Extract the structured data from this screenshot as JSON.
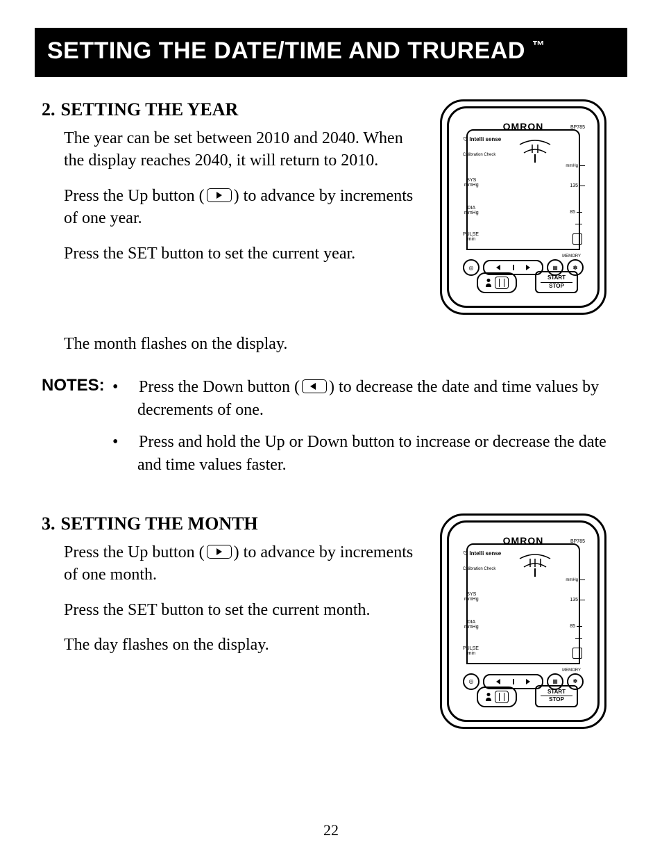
{
  "title": "SETTING THE DATE/TIME AND TRUREAD",
  "tm": "™",
  "sec2": {
    "num": "2.",
    "heading": "SETTING THE YEAR",
    "p1": "The year can be set between 2010 and 2040. When the display reaches 2040, it will return to 2010.",
    "p2a": "Press the Up button (",
    "p2b": ") to advance by increments of one year.",
    "p3": "Press the SET button to set the current year.",
    "p4": "The month flashes on the display."
  },
  "notes": {
    "label": "NOTES:",
    "n1a": "Press the Down button (",
    "n1b": ") to decrease the date and time values by decrements of one.",
    "n2": "Press and hold the Up or Down button to increase or decrease the date and time values faster."
  },
  "sec3": {
    "num": "3.",
    "heading": "SETTING THE MONTH",
    "p1a": "Press the Up button (",
    "p1b": ") to advance by increments of one month.",
    "p2": "Press the SET button to set the current month.",
    "p3": "The day flashes on the display."
  },
  "device": {
    "brand": "OMRON",
    "model": "BP785",
    "intelli": "Intelli sense",
    "cal": "Calibration Check",
    "sys": "SYS",
    "sys_u": "mmHg",
    "dia": "DIA",
    "dia_u": "mmHg",
    "pulse": "PULSE",
    "pulse_u": "/min",
    "mmhg": "mmHg",
    "v135": "135",
    "v85": "85",
    "memory": "MEMORY",
    "start": "START",
    "stop": "STOP"
  },
  "page": "22"
}
